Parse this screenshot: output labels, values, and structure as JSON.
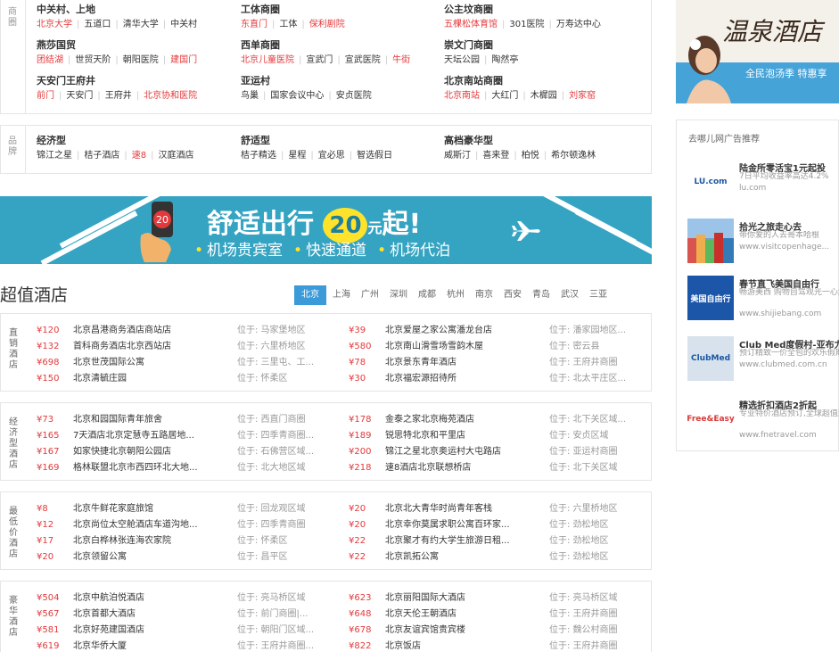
{
  "business": {
    "side_label": "商圈",
    "columns": [
      [
        {
          "title": "中关村、上地",
          "links": [
            {
              "t": "北京大学",
              "red": true
            },
            {
              "t": "五道口"
            },
            {
              "t": "清华大学"
            },
            {
              "t": "中关村"
            }
          ]
        },
        {
          "title": "燕莎国贸",
          "links": [
            {
              "t": "团结湖",
              "red": true
            },
            {
              "t": "世贸天阶"
            },
            {
              "t": "朝阳医院"
            },
            {
              "t": "建国门",
              "red": true
            }
          ]
        },
        {
          "title": "天安门王府井",
          "links": [
            {
              "t": "前门",
              "red": true
            },
            {
              "t": "天安门"
            },
            {
              "t": "王府井"
            },
            {
              "t": "北京协和医院",
              "red": true
            }
          ]
        }
      ],
      [
        {
          "title": "工体商圈",
          "links": [
            {
              "t": "东直门",
              "red": true
            },
            {
              "t": "工体"
            },
            {
              "t": "保利剧院",
              "red": true
            }
          ]
        },
        {
          "title": "西单商圈",
          "links": [
            {
              "t": "北京儿童医院",
              "red": true
            },
            {
              "t": "宣武门"
            },
            {
              "t": "宣武医院"
            },
            {
              "t": "牛街",
              "red": true
            }
          ]
        },
        {
          "title": "亚运村",
          "links": [
            {
              "t": "鸟巢"
            },
            {
              "t": "国家会议中心"
            },
            {
              "t": "安贞医院"
            }
          ]
        }
      ],
      [
        {
          "title": "公主坟商圈",
          "links": [
            {
              "t": "五棵松体育馆",
              "red": true
            },
            {
              "t": "301医院"
            },
            {
              "t": "万寿达中心"
            }
          ]
        },
        {
          "title": "崇文门商圈",
          "links": [
            {
              "t": "天坛公园"
            },
            {
              "t": "陶然亭"
            }
          ]
        },
        {
          "title": "北京南站商圈",
          "links": [
            {
              "t": "北京南站",
              "red": true
            },
            {
              "t": "大红门"
            },
            {
              "t": "木樨园"
            },
            {
              "t": "刘家窑",
              "red": true
            }
          ]
        }
      ]
    ]
  },
  "brand": {
    "side_label": "品牌",
    "columns": [
      {
        "title": "经济型",
        "links": [
          {
            "t": "锦江之星"
          },
          {
            "t": "桔子酒店"
          },
          {
            "t": "速8",
            "red": true
          },
          {
            "t": "汉庭酒店"
          }
        ]
      },
      {
        "title": "舒适型",
        "links": [
          {
            "t": "桔子精选"
          },
          {
            "t": "星程"
          },
          {
            "t": "宜必思"
          },
          {
            "t": "智选假日"
          }
        ]
      },
      {
        "title": "高档豪华型",
        "links": [
          {
            "t": "威斯汀"
          },
          {
            "t": "喜来登"
          },
          {
            "t": "柏悦"
          },
          {
            "t": "希尔顿逸林"
          }
        ]
      }
    ]
  },
  "banner": {
    "badge": "20",
    "main_pre": "舒适出行",
    "main_num": "20",
    "main_unit": "元",
    "main_post": "起!",
    "sub_items": [
      "机场贵宾室",
      "快速通道",
      "机场代泊"
    ]
  },
  "super_value": {
    "title": "超值酒店",
    "tabs": [
      "北京",
      "上海",
      "广州",
      "深圳",
      "成都",
      "杭州",
      "南京",
      "西安",
      "青岛",
      "武汉",
      "三亚"
    ],
    "active_tab": 0,
    "loc_prefix": "位于: ",
    "sections": [
      {
        "label": "直销酒店",
        "left": [
          {
            "price": "¥120",
            "name": "北京昌港商务酒店商站店",
            "loc": "马家堡地区"
          },
          {
            "price": "¥132",
            "name": "首科商务酒店北京西站店",
            "loc": "六里桥地区"
          },
          {
            "price": "¥698",
            "name": "北京世茂国际公寓",
            "loc": "三里屯、工..."
          },
          {
            "price": "¥150",
            "name": "北京清毓庄园",
            "loc": "怀柔区"
          }
        ],
        "right": [
          {
            "price": "¥39",
            "name": "北京爱屋之家公寓潘龙台店",
            "loc": "潘家园地区..."
          },
          {
            "price": "¥580",
            "name": "北京南山滑雪场雪韵木屋",
            "loc": "密云县"
          },
          {
            "price": "¥78",
            "name": "北京景东青年酒店",
            "loc": "王府井商圈"
          },
          {
            "price": "¥30",
            "name": "北京福宏源招待所",
            "loc": "北太平庄区..."
          }
        ]
      },
      {
        "label": "经济型酒店",
        "left": [
          {
            "price": "¥73",
            "name": "北京和园国际青年旅舍",
            "loc": "西直门商圈"
          },
          {
            "price": "¥165",
            "name": "7天酒店北京定慧寺五路居地...",
            "loc": "四季青商圈..."
          },
          {
            "price": "¥167",
            "name": "如家快捷北京朝阳公园店",
            "loc": "石佛营区域..."
          },
          {
            "price": "¥169",
            "name": "格林联盟北京市西四环北大地...",
            "loc": "北大地区域"
          }
        ],
        "right": [
          {
            "price": "¥178",
            "name": "金泰之家北京梅苑酒店",
            "loc": "北下关区域..."
          },
          {
            "price": "¥189",
            "name": "锐思特北京和平里店",
            "loc": "安贞区域"
          },
          {
            "price": "¥200",
            "name": "锦江之星北京奥运村大屯路店",
            "loc": "亚运村商圈"
          },
          {
            "price": "¥218",
            "name": "速8酒店北京联想桥店",
            "loc": "北下关区域"
          }
        ]
      },
      {
        "label": "最低价酒店",
        "left": [
          {
            "price": "¥8",
            "name": "北京牛鲜花家庭旅馆",
            "loc": "回龙观区域"
          },
          {
            "price": "¥12",
            "name": "北京尚位太空舱酒店车道沟地...",
            "loc": "四季青商圈"
          },
          {
            "price": "¥17",
            "name": "北京白桦林张连海农家院",
            "loc": "怀柔区"
          },
          {
            "price": "¥20",
            "name": "北京领留公寓",
            "loc": "昌平区"
          }
        ],
        "right": [
          {
            "price": "¥20",
            "name": "北京北大青华时尚青年客栈",
            "loc": "六里桥地区"
          },
          {
            "price": "¥20",
            "name": "北京幸你莫属求职公寓百环家...",
            "loc": "劲松地区"
          },
          {
            "price": "¥22",
            "name": "北京聚才有约大学生旅游日租...",
            "loc": "劲松地区"
          },
          {
            "price": "¥22",
            "name": "北京凯拓公寓",
            "loc": "劲松地区"
          }
        ]
      },
      {
        "label": "豪华酒店",
        "left": [
          {
            "price": "¥504",
            "name": "北京中航泊悦酒店",
            "loc": "亮马桥区域"
          },
          {
            "price": "¥567",
            "name": "北京首都大酒店",
            "loc": "前门商圈|..."
          },
          {
            "price": "¥581",
            "name": "北京好苑建国酒店",
            "loc": "朝阳门区域..."
          },
          {
            "price": "¥619",
            "name": "北京华侨大厦",
            "loc": "王府井商圈..."
          }
        ],
        "right": [
          {
            "price": "¥623",
            "name": "北京丽阳国际大酒店",
            "loc": "亮马桥区域"
          },
          {
            "price": "¥648",
            "name": "北京天伦王朝酒店",
            "loc": "王府井商圈"
          },
          {
            "price": "¥678",
            "name": "北京友谊宾馆贵宾楼",
            "loc": "魏公村商圈"
          },
          {
            "price": "¥822",
            "name": "北京饭店",
            "loc": "王府井商圈"
          }
        ]
      }
    ]
  },
  "right_ad": {
    "title": "温泉酒店",
    "strip_text": "全民泡汤季 特惠享"
  },
  "ads": {
    "heading": "去哪儿网广告推荐",
    "items": [
      {
        "logo": "LU.com",
        "t1": "陆金所零活宝1元起投",
        "t2": "7日平均收益率高达4.2%",
        "t3": "lu.com"
      },
      {
        "logo": "",
        "t1": "拾光之旅走心去",
        "t2": "带你爱的人去哥本哈根",
        "t3": "www.visitcopenhage..."
      },
      {
        "logo": "美国自由行",
        "t1": "春节直飞美国自由行",
        "t2": "畅游美西 购物自驾观光一心游",
        "t3": "www.shijiebang.com"
      },
      {
        "logo": "ClubMed",
        "t1": "Club Med度假村-亚布力",
        "t2": "预订精致一价全包的欢乐假期",
        "t3": "www.clubmed.com.cn"
      },
      {
        "logo": "Free&Easy",
        "t1": "精选折扣酒店2折起",
        "t2": "专业特价酒店预订,全球超值酒店。",
        "t3": "www.fnetravel.com"
      }
    ]
  }
}
